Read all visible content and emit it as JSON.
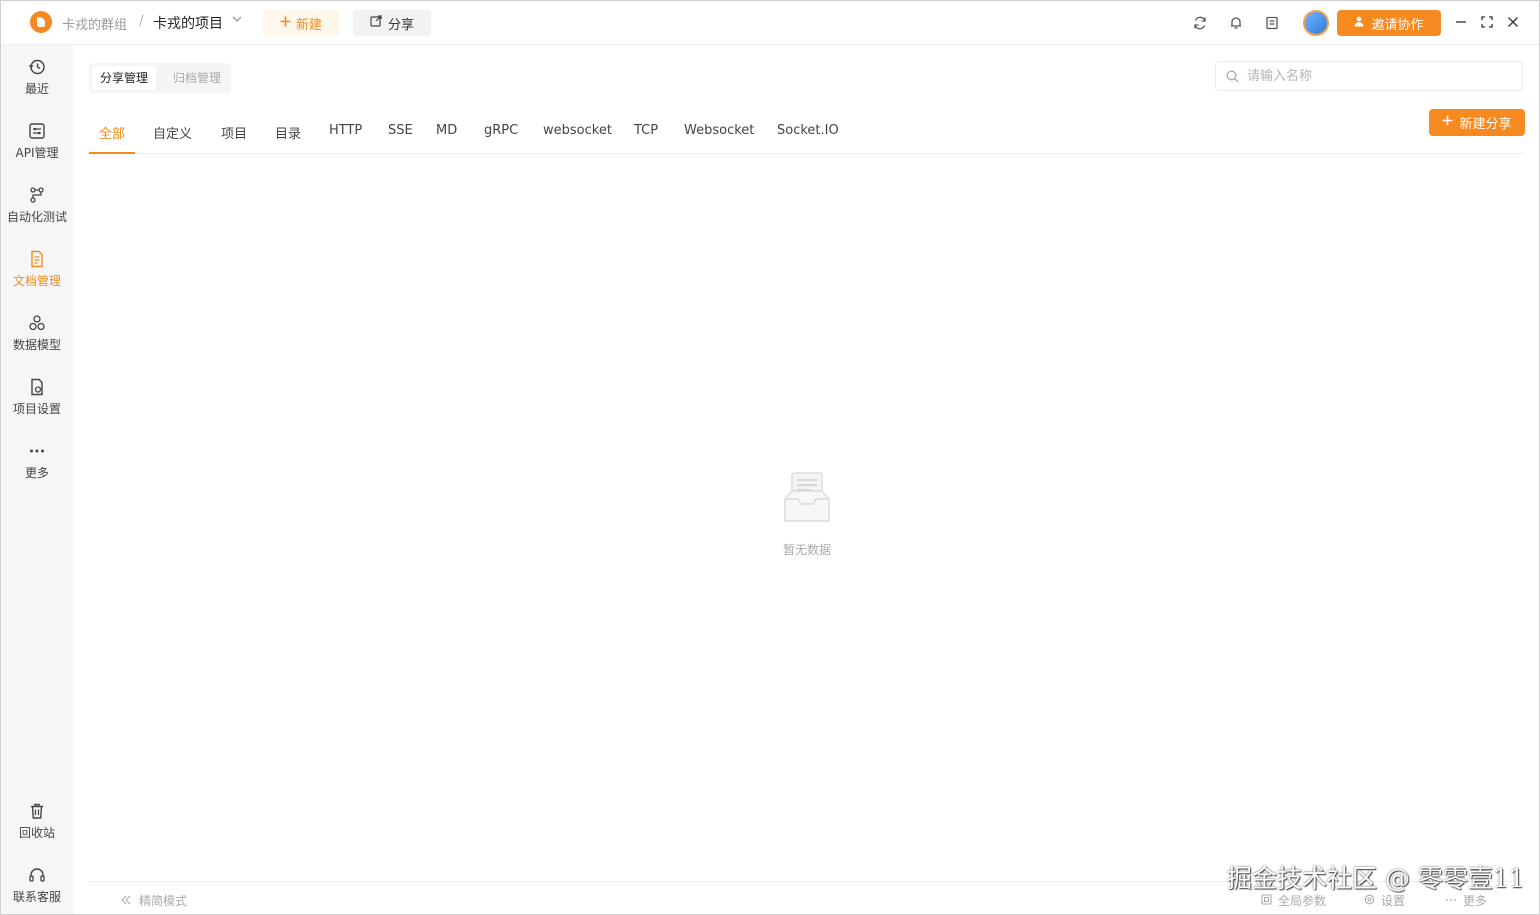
{
  "header": {
    "team_name": "卡戎的群组",
    "separator": "/",
    "project_name": "卡戎的项目",
    "new_label": "新建",
    "share_label": "分享",
    "invite_label": "邀请协作"
  },
  "sidebar": {
    "items": [
      {
        "label": "最近",
        "icon": "history-icon"
      },
      {
        "label": "API管理",
        "icon": "api-icon"
      },
      {
        "label": "自动化测试",
        "icon": "automation-icon"
      },
      {
        "label": "文档管理",
        "icon": "document-icon",
        "active": true
      },
      {
        "label": "数据模型",
        "icon": "data-model-icon"
      },
      {
        "label": "项目设置",
        "icon": "project-settings-icon"
      },
      {
        "label": "更多",
        "icon": "more-icon"
      }
    ],
    "bottom_items": [
      {
        "label": "回收站",
        "icon": "trash-icon"
      },
      {
        "label": "联系客服",
        "icon": "headset-icon"
      }
    ]
  },
  "main": {
    "subtabs": [
      "分享管理",
      "归档管理"
    ],
    "search": {
      "placeholder": "请输入名称",
      "value": ""
    },
    "new_share_label": "新建分享",
    "tabs": [
      "全部",
      "自定义",
      "项目",
      "目录",
      "HTTP",
      "SSE",
      "MD",
      "gRPC",
      "websocket",
      "TCP",
      "Websocket",
      "Socket.IO"
    ],
    "active_tab": "全部",
    "empty_text": "暂无数据"
  },
  "footer": {
    "simple_mode": "精简模式",
    "global_params": "全局参数",
    "settings": "设置",
    "more": "更多"
  },
  "watermark": "掘金技术社区 @ 零零壹11",
  "colors": {
    "accent": "#f08d1e",
    "sidebar_bg": "#f6f6f7"
  }
}
